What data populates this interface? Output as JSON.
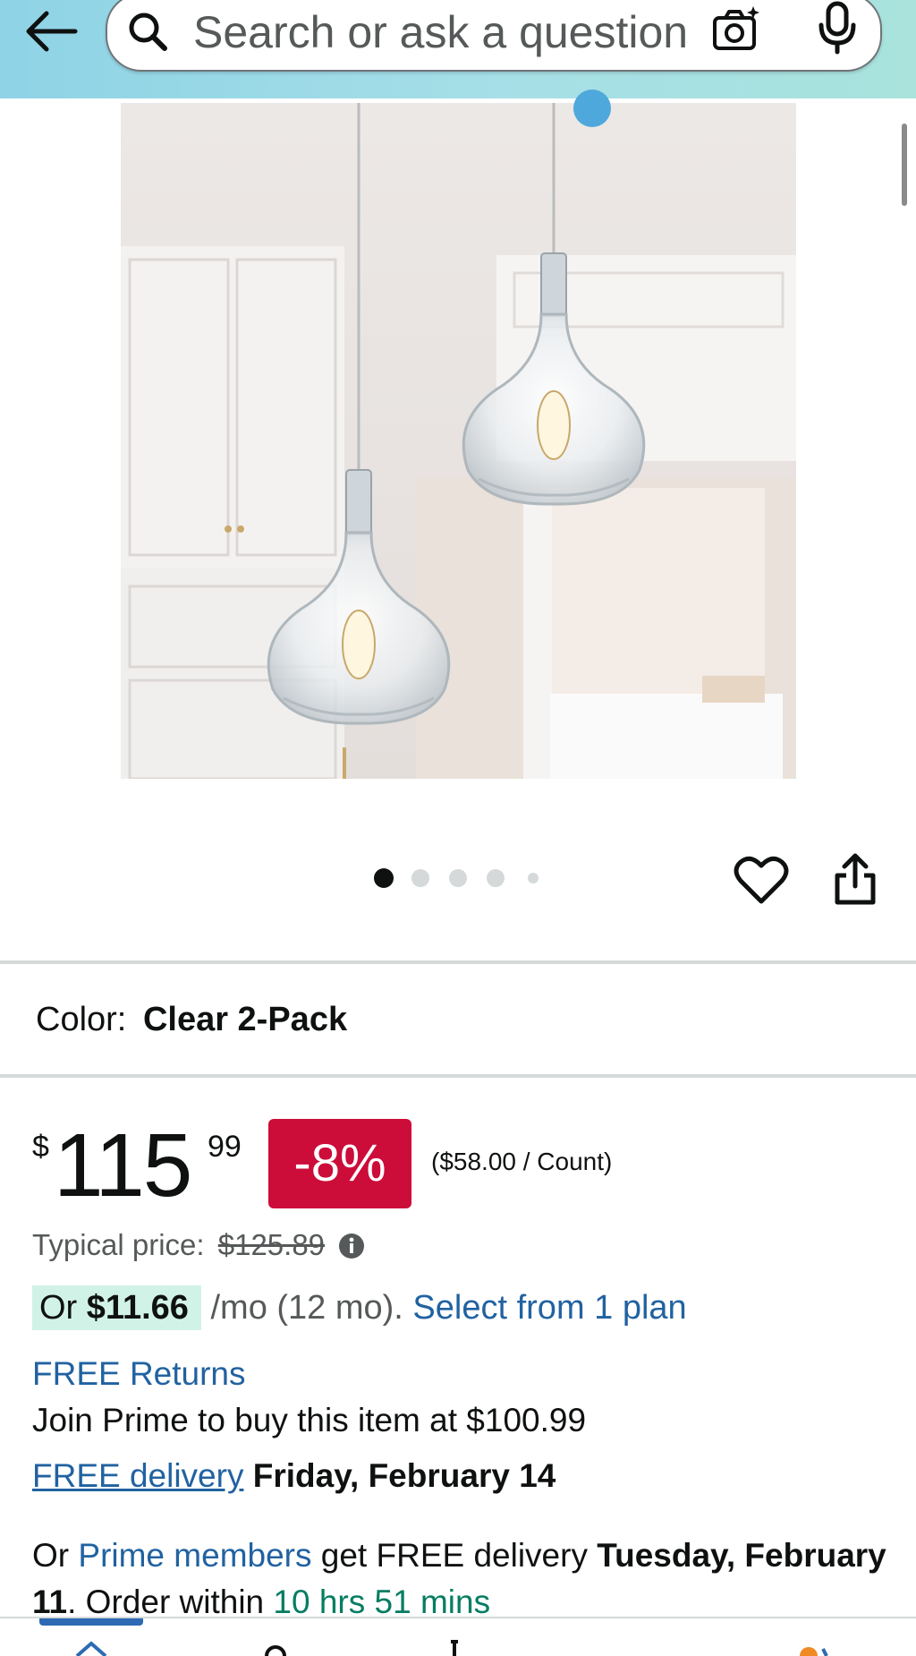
{
  "header": {
    "search_placeholder": "Search or ask a question"
  },
  "carousel": {
    "dot_count": 5,
    "active_index": 0
  },
  "product": {
    "color_label": "Color:",
    "color_value": "Clear 2-Pack"
  },
  "price": {
    "currency": "$",
    "whole": "115",
    "fraction": "99",
    "discount": "-8%",
    "unit_price": "($58.00 / Count)",
    "typical_label": "Typical price:",
    "typical_value": "$125.89"
  },
  "plan": {
    "prefix": "Or ",
    "amount": "$11.66",
    "term": " /mo (12 mo). ",
    "link": "Select from 1 plan"
  },
  "delivery": {
    "free_returns": "FREE Returns",
    "prime_join": "Join Prime to buy this item at $100.99",
    "free_delivery_link": "FREE delivery",
    "delivery_date": "Friday, February 14",
    "prime_prefix": "Or ",
    "prime_link": "Prime members",
    "prime_mid": " get FREE delivery ",
    "prime_date": "Tuesday, February 11",
    "order_prefix": ". Order within ",
    "order_time": "10 hrs 51 mins"
  },
  "colors": {
    "header_gradient_start": "#8ed3e6",
    "header_gradient_end": "#a9e3dc",
    "discount_badge": "#cc0c39",
    "link": "#2162a1",
    "plan_highlight": "#d1f3e7",
    "countdown_green": "#067d62"
  }
}
